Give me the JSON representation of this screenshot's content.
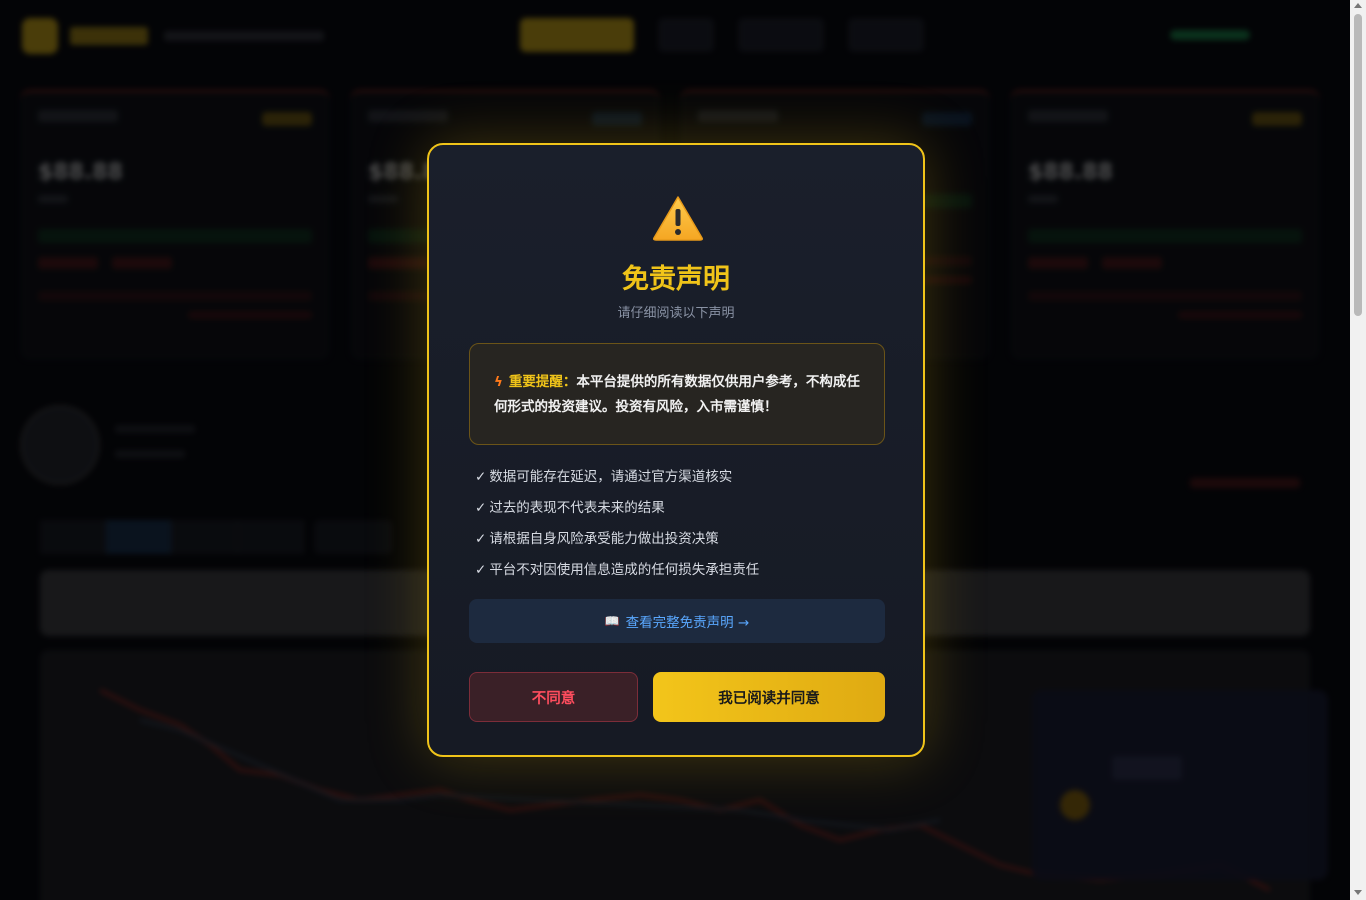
{
  "colors": {
    "accent": "#f0c419",
    "danger": "#ff4d5e",
    "link": "#5aa8ff",
    "background": "#07080c",
    "modal_bg": "#1a1f2b"
  },
  "background_app": {
    "card_prices": [
      "$88.88",
      "$88.88",
      "",
      "$88.88"
    ]
  },
  "modal": {
    "icon": "warning-triangle-icon",
    "title": "免责声明",
    "subtitle": "请仔细阅读以下声明",
    "notice": {
      "icon": "lightning-icon",
      "label": "重要提醒：",
      "text": "本平台提供的所有数据仅供用户参考，不构成任何形式的投资建议。投资有风险，入市需谨慎！"
    },
    "checklist": [
      "数据可能存在延迟，请通过官方渠道核实",
      "过去的表现不代表未来的结果",
      "请根据自身风险承受能力做出投资决策",
      "平台不对因使用信息造成的任何损失承担责任"
    ],
    "check_symbol": "✓",
    "full_link": {
      "icon": "book-icon",
      "label": "查看完整免责声明 →"
    },
    "buttons": {
      "disagree": "不同意",
      "agree": "我已阅读并同意"
    }
  }
}
